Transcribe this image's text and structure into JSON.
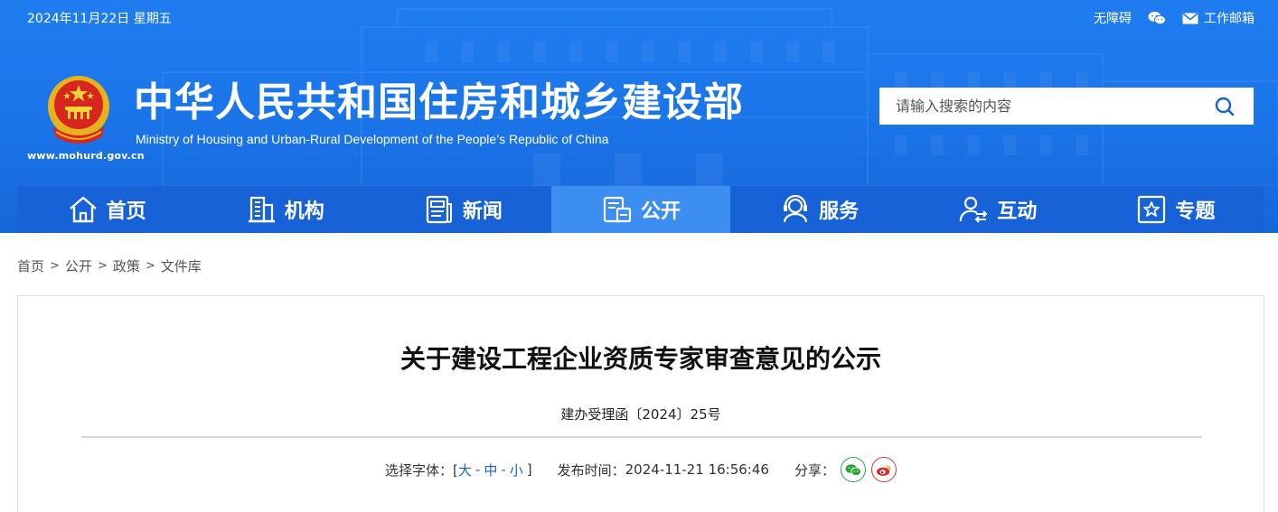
{
  "topbar": {
    "date": "2024年11月22日 星期五",
    "accessibility": "无障碍",
    "mailbox": "工作邮箱"
  },
  "site": {
    "title_cn": "中华人民共和国住房和城乡建设部",
    "title_en": "Ministry of Housing and Urban-Rural Development of the People’s Republic of China",
    "domain": "www.mohurd.gov.cn"
  },
  "search": {
    "placeholder": "请输入搜索的内容"
  },
  "nav": {
    "items": [
      {
        "label": "首页",
        "icon": "home-icon"
      },
      {
        "label": "机构",
        "icon": "building-icon"
      },
      {
        "label": "新闻",
        "icon": "news-icon"
      },
      {
        "label": "公开",
        "icon": "disclosure-icon",
        "active": true
      },
      {
        "label": "服务",
        "icon": "service-icon"
      },
      {
        "label": "互动",
        "icon": "interaction-icon"
      },
      {
        "label": "专题",
        "icon": "topic-icon"
      }
    ]
  },
  "breadcrumb": {
    "items": [
      "首页",
      "公开",
      "政策",
      "文件库"
    ],
    "separator": ">"
  },
  "article": {
    "title": "关于建设工程企业资质专家审查意见的公示",
    "doc_number": "建办受理函〔2024〕25号",
    "font_label": "选择字体：[",
    "font_large": "大",
    "font_medium": "中",
    "font_small": "小",
    "font_close": "]",
    "publish_label": "发布时间：",
    "publish_time": "2024-11-21 16:56:46",
    "share_label": "分享："
  },
  "colors": {
    "header_blue": "#1a74e8",
    "nav_blue": "#1662d6",
    "nav_active": "#3c8ef0",
    "link_blue": "#1b62c9",
    "wechat_green": "#2aa536",
    "weibo_red": "#d62f2f"
  }
}
